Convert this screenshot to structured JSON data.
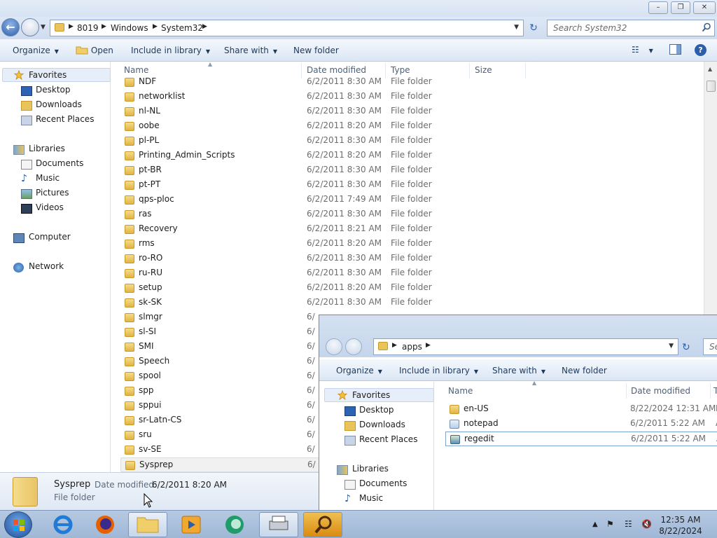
{
  "main_window": {
    "breadcrumbs": [
      "8019",
      "Windows",
      "System32"
    ],
    "search_placeholder": "Search System32",
    "toolbar": {
      "organize": "Organize",
      "open": "Open",
      "include": "Include in library",
      "share": "Share with",
      "new_folder": "New folder"
    },
    "nav": {
      "favorites": "Favorites",
      "desktop": "Desktop",
      "downloads": "Downloads",
      "recent": "Recent Places",
      "libraries": "Libraries",
      "documents": "Documents",
      "music": "Music",
      "pictures": "Pictures",
      "videos": "Videos",
      "computer": "Computer",
      "network": "Network"
    },
    "columns": [
      "Name",
      "Date modified",
      "Type",
      "Size"
    ],
    "files": [
      {
        "name": "NDF",
        "date": "6/2/2011 8:30 AM",
        "type": "File folder"
      },
      {
        "name": "networklist",
        "date": "6/2/2011 8:30 AM",
        "type": "File folder"
      },
      {
        "name": "nl-NL",
        "date": "6/2/2011 8:30 AM",
        "type": "File folder"
      },
      {
        "name": "oobe",
        "date": "6/2/2011 8:20 AM",
        "type": "File folder"
      },
      {
        "name": "pl-PL",
        "date": "6/2/2011 8:30 AM",
        "type": "File folder"
      },
      {
        "name": "Printing_Admin_Scripts",
        "date": "6/2/2011 8:20 AM",
        "type": "File folder"
      },
      {
        "name": "pt-BR",
        "date": "6/2/2011 8:30 AM",
        "type": "File folder"
      },
      {
        "name": "pt-PT",
        "date": "6/2/2011 8:30 AM",
        "type": "File folder"
      },
      {
        "name": "qps-ploc",
        "date": "6/2/2011 7:49 AM",
        "type": "File folder"
      },
      {
        "name": "ras",
        "date": "6/2/2011 8:30 AM",
        "type": "File folder"
      },
      {
        "name": "Recovery",
        "date": "6/2/2011 8:21 AM",
        "type": "File folder"
      },
      {
        "name": "rms",
        "date": "6/2/2011 8:20 AM",
        "type": "File folder"
      },
      {
        "name": "ro-RO",
        "date": "6/2/2011 8:30 AM",
        "type": "File folder"
      },
      {
        "name": "ru-RU",
        "date": "6/2/2011 8:30 AM",
        "type": "File folder"
      },
      {
        "name": "setup",
        "date": "6/2/2011 8:20 AM",
        "type": "File folder"
      },
      {
        "name": "sk-SK",
        "date": "6/2/2011 8:30 AM",
        "type": "File folder"
      },
      {
        "name": "slmgr",
        "date": "6/",
        "type": ""
      },
      {
        "name": "sl-SI",
        "date": "6/",
        "type": ""
      },
      {
        "name": "SMI",
        "date": "6/",
        "type": ""
      },
      {
        "name": "Speech",
        "date": "6/",
        "type": ""
      },
      {
        "name": "spool",
        "date": "6/",
        "type": ""
      },
      {
        "name": "spp",
        "date": "6/",
        "type": ""
      },
      {
        "name": "sppui",
        "date": "6/",
        "type": ""
      },
      {
        "name": "sr-Latn-CS",
        "date": "6/",
        "type": ""
      },
      {
        "name": "sru",
        "date": "6/",
        "type": ""
      },
      {
        "name": "sv-SE",
        "date": "6/",
        "type": ""
      },
      {
        "name": "Sysprep",
        "date": "6/",
        "type": ""
      }
    ],
    "details": {
      "name": "Sysprep",
      "date_label": "Date modified:",
      "date_value": "6/2/2011 8:20 AM",
      "type": "File folder"
    }
  },
  "second_window": {
    "breadcrumbs": [
      "apps"
    ],
    "search_placeholder": "Se",
    "toolbar": {
      "organize": "Organize",
      "include": "Include in library",
      "share": "Share with",
      "new_folder": "New folder"
    },
    "nav": {
      "favorites": "Favorites",
      "desktop": "Desktop",
      "downloads": "Downloads",
      "recent": "Recent Places",
      "libraries": "Libraries",
      "documents": "Documents",
      "music": "Music"
    },
    "columns": [
      "Name",
      "Date modified",
      "T"
    ],
    "files": [
      {
        "name": "en-US",
        "date": "8/22/2024 12:31 AM",
        "type_trunc": "F"
      },
      {
        "name": "notepad",
        "date": "6/2/2011 5:22 AM",
        "type_trunc": "A"
      },
      {
        "name": "regedit",
        "date": "6/2/2011 5:22 AM",
        "type_trunc": "A"
      }
    ]
  },
  "taskbar": {
    "time": "12:35 AM",
    "date": "8/22/2024"
  },
  "colors": {
    "accent": "#2d5fa8",
    "folder": "#e1b443",
    "taskbar": "#a9bfdc"
  }
}
